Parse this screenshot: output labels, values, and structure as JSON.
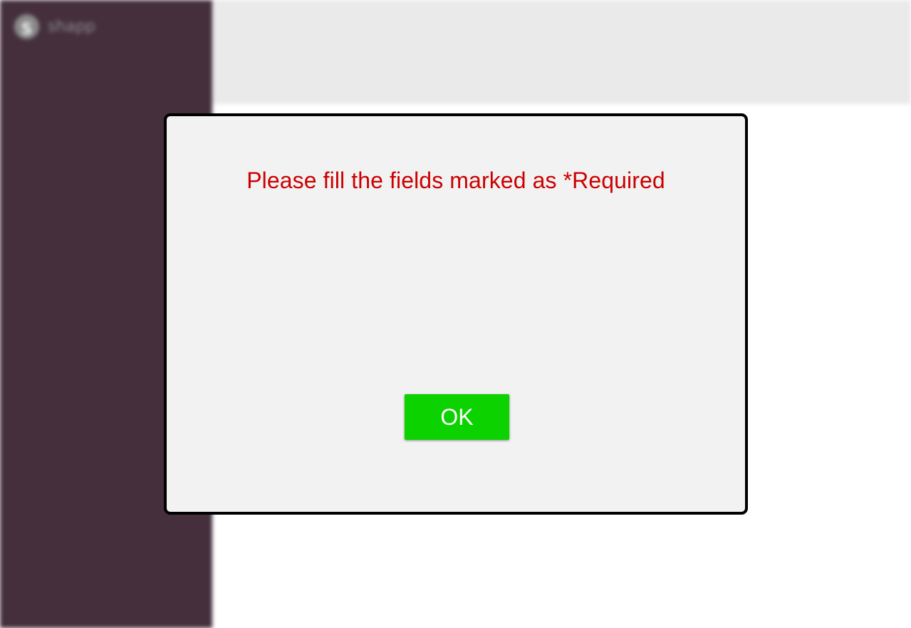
{
  "app": {
    "brand_initial": "S",
    "brand_name": "shapp"
  },
  "dialog": {
    "message": "Please fill the fields marked as *Required",
    "ok_label": "OK"
  },
  "colors": {
    "sidebar": "#452f3c",
    "header": "#eaeaea",
    "dialog_background": "#f2f2f2",
    "message": "#cc0000",
    "ok_button": "#0cd300"
  },
  "icons": {
    "brand_logo": "brand-logo-icon"
  }
}
